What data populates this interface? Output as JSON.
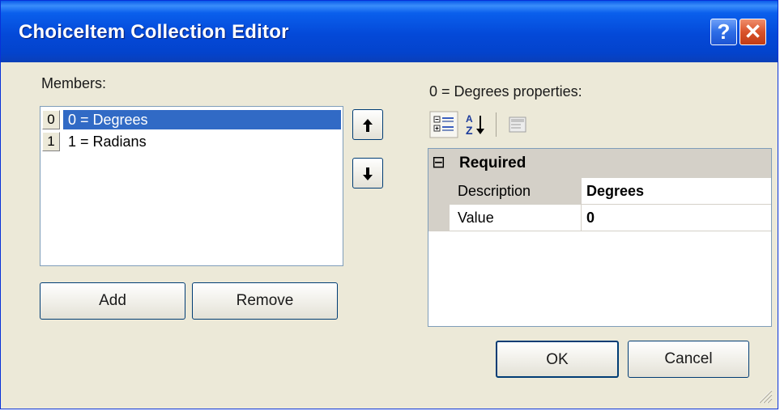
{
  "window": {
    "title": "ChoiceItem Collection Editor",
    "help_label": "?",
    "close_label": "✕"
  },
  "members": {
    "label": "Members:",
    "items": [
      {
        "index": "0",
        "text": "0 = Degrees",
        "selected": true
      },
      {
        "index": "1",
        "text": "1 = Radians",
        "selected": false
      }
    ],
    "move_up_icon": "arrow-up",
    "move_down_icon": "arrow-down",
    "move_up_glyph": "🠅",
    "move_down_glyph": "🠇",
    "add_label": "Add",
    "remove_label": "Remove"
  },
  "properties": {
    "label": "0 = Degrees properties:",
    "toolbar": [
      "categorized-icon",
      "alphabetical-icon",
      "property-pages-icon"
    ],
    "category": {
      "expander": "⊟",
      "name": "Required"
    },
    "rows": [
      {
        "name": "Description",
        "value": "Degrees"
      },
      {
        "name": "Value",
        "value": "0"
      }
    ]
  },
  "buttons": {
    "ok_label": "OK",
    "cancel_label": "Cancel"
  },
  "colors": {
    "titlebar": "#0449d8",
    "selection": "#316ac5",
    "dialog_bg": "#ece9d8",
    "close_button": "#d9532b"
  }
}
